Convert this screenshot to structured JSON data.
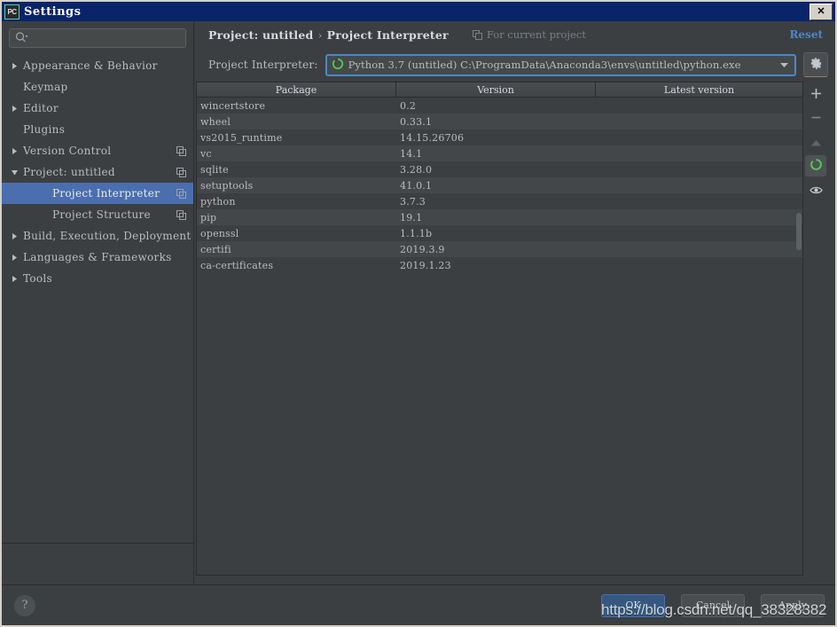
{
  "window": {
    "title": "Settings",
    "icon": "pycharm-icon",
    "close_label": "✕"
  },
  "sidebar": {
    "search": {
      "placeholder": "",
      "value": "",
      "icon": "search-icon"
    },
    "items": [
      {
        "label": "Appearance & Behavior",
        "arrow": "collapsed",
        "depth": 1,
        "copy": false,
        "selected": false
      },
      {
        "label": "Keymap",
        "arrow": "none",
        "depth": 1,
        "copy": false,
        "selected": false
      },
      {
        "label": "Editor",
        "arrow": "collapsed",
        "depth": 1,
        "copy": false,
        "selected": false
      },
      {
        "label": "Plugins",
        "arrow": "none",
        "depth": 1,
        "copy": false,
        "selected": false
      },
      {
        "label": "Version Control",
        "arrow": "collapsed",
        "depth": 1,
        "copy": true,
        "selected": false
      },
      {
        "label": "Project: untitled",
        "arrow": "expanded",
        "depth": 1,
        "copy": true,
        "selected": false
      },
      {
        "label": "Project Interpreter",
        "arrow": "none",
        "depth": 2,
        "copy": true,
        "selected": true
      },
      {
        "label": "Project Structure",
        "arrow": "none",
        "depth": 2,
        "copy": true,
        "selected": false
      },
      {
        "label": "Build, Execution, Deployment",
        "arrow": "collapsed",
        "depth": 1,
        "copy": false,
        "selected": false
      },
      {
        "label": "Languages & Frameworks",
        "arrow": "collapsed",
        "depth": 1,
        "copy": false,
        "selected": false
      },
      {
        "label": "Tools",
        "arrow": "collapsed",
        "depth": 1,
        "copy": false,
        "selected": false
      }
    ]
  },
  "main": {
    "breadcrumb": {
      "root": "Project: untitled",
      "separator": "›",
      "leaf": "Project Interpreter"
    },
    "scope_note": {
      "label": "For current project",
      "icon": "copy-icon"
    },
    "reset_label": "Reset",
    "interpreter": {
      "label": "Project Interpreter:",
      "value": "Python 3.7 (untitled) C:\\ProgramData\\Anaconda3\\envs\\untitled\\python.exe",
      "status_icon": "python-env-icon",
      "dropdown_icon": "chevron-down-icon",
      "settings_icon": "gear-icon"
    },
    "table": {
      "columns": [
        "Package",
        "Version",
        "Latest version"
      ],
      "rows": [
        {
          "package": "ca-certificates",
          "version": "2019.1.23",
          "latest": "",
          "loading": true
        },
        {
          "package": "certifi",
          "version": "2019.3.9",
          "latest": "",
          "loading": false
        },
        {
          "package": "openssl",
          "version": "1.1.1b",
          "latest": "",
          "loading": false
        },
        {
          "package": "pip",
          "version": "19.1",
          "latest": "",
          "loading": false
        },
        {
          "package": "python",
          "version": "3.7.3",
          "latest": "",
          "loading": false
        },
        {
          "package": "setuptools",
          "version": "41.0.1",
          "latest": "",
          "loading": false
        },
        {
          "package": "sqlite",
          "version": "3.28.0",
          "latest": "",
          "loading": false
        },
        {
          "package": "vc",
          "version": "14.1",
          "latest": "",
          "loading": false
        },
        {
          "package": "vs2015_runtime",
          "version": "14.15.26706",
          "latest": "",
          "loading": false
        },
        {
          "package": "wheel",
          "version": "0.33.1",
          "latest": "",
          "loading": false
        },
        {
          "package": "wincertstore",
          "version": "0.2",
          "latest": "",
          "loading": false
        }
      ]
    },
    "toolbar": [
      {
        "icon": "plus-icon",
        "name": "install-package-button",
        "active": false
      },
      {
        "icon": "minus-icon",
        "name": "uninstall-package-button",
        "active": false
      },
      {
        "icon": "arrow-up-icon",
        "name": "upgrade-package-button",
        "active": false
      },
      {
        "icon": "python-env-icon",
        "name": "conda-env-button",
        "active": true
      },
      {
        "icon": "eye-icon",
        "name": "show-early-releases-button",
        "active": false
      }
    ]
  },
  "footer": {
    "help_label": "?",
    "buttons": [
      {
        "label": "OK",
        "style": "primary"
      },
      {
        "label": "Cancel",
        "style": "normal"
      },
      {
        "label": "Apply",
        "style": "normal"
      }
    ]
  },
  "watermark": {
    "text": "https://blog.csdn.net/qq_38328382"
  },
  "colors": {
    "background": "#3c3f41",
    "titlebar": "#0a246a",
    "selection": "#4b6eaf",
    "accent_link": "#4a88c7",
    "primary_button": "#365880",
    "text": "#bbbbbb",
    "green_status": "#4fc94f"
  }
}
